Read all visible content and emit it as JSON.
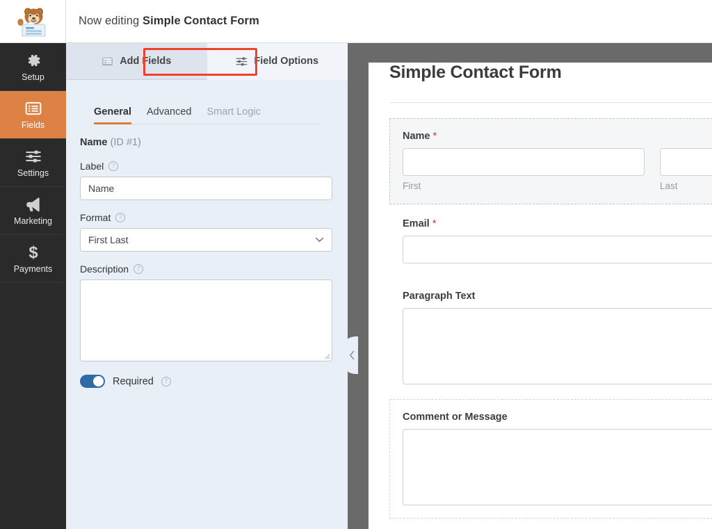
{
  "header": {
    "logo_alt": "wpforms-mascot-logo",
    "prefix": "Now editing",
    "form_name": "Simple Contact Form"
  },
  "sidebar": {
    "items": [
      {
        "label": "Setup",
        "icon": "gear-icon",
        "active": false
      },
      {
        "label": "Fields",
        "icon": "list-icon",
        "active": true
      },
      {
        "label": "Settings",
        "icon": "sliders-icon",
        "active": false
      },
      {
        "label": "Marketing",
        "icon": "megaphone-icon",
        "active": false
      },
      {
        "label": "Payments",
        "icon": "dollar-icon",
        "active": false
      }
    ],
    "active_color": "#dd8145",
    "background": "#2a2a2a"
  },
  "panel": {
    "tabs": [
      {
        "label": "Add Fields",
        "icon": "fields-list-icon",
        "active": false
      },
      {
        "label": "Field Options",
        "icon": "sliders-icon",
        "active": true
      }
    ],
    "highlight_color": "#f0422a",
    "subtabs": [
      {
        "label": "General",
        "state": "active"
      },
      {
        "label": "Advanced",
        "state": "normal"
      },
      {
        "label": "Smart Logic",
        "state": "disabled"
      }
    ],
    "field_heading": "Name",
    "field_id": "(ID #1)",
    "options": {
      "label_label": "Label",
      "label_value": "Name",
      "format_label": "Format",
      "format_value": "First Last",
      "description_label": "Description",
      "description_value": "",
      "required_label": "Required",
      "required_on": true,
      "help_icon": "help-circle-icon",
      "toggle_color": "#2f6ba6"
    }
  },
  "collapse": {
    "icon": "chevron-left-icon"
  },
  "preview": {
    "title": "Simple Contact Form",
    "fields": [
      {
        "label": "Name",
        "required": true,
        "required_mark": "*",
        "type": "name",
        "state": "selected",
        "sublabels": [
          "First",
          "Last"
        ]
      },
      {
        "label": "Email",
        "required": true,
        "required_mark": "*",
        "type": "text",
        "state": "plain",
        "sublabels": []
      },
      {
        "label": "Paragraph Text",
        "required": false,
        "required_mark": "",
        "type": "textarea",
        "state": "plain",
        "sublabels": []
      },
      {
        "label": "Comment or Message",
        "required": false,
        "required_mark": "",
        "type": "textarea",
        "state": "hovered",
        "sublabels": []
      }
    ]
  }
}
